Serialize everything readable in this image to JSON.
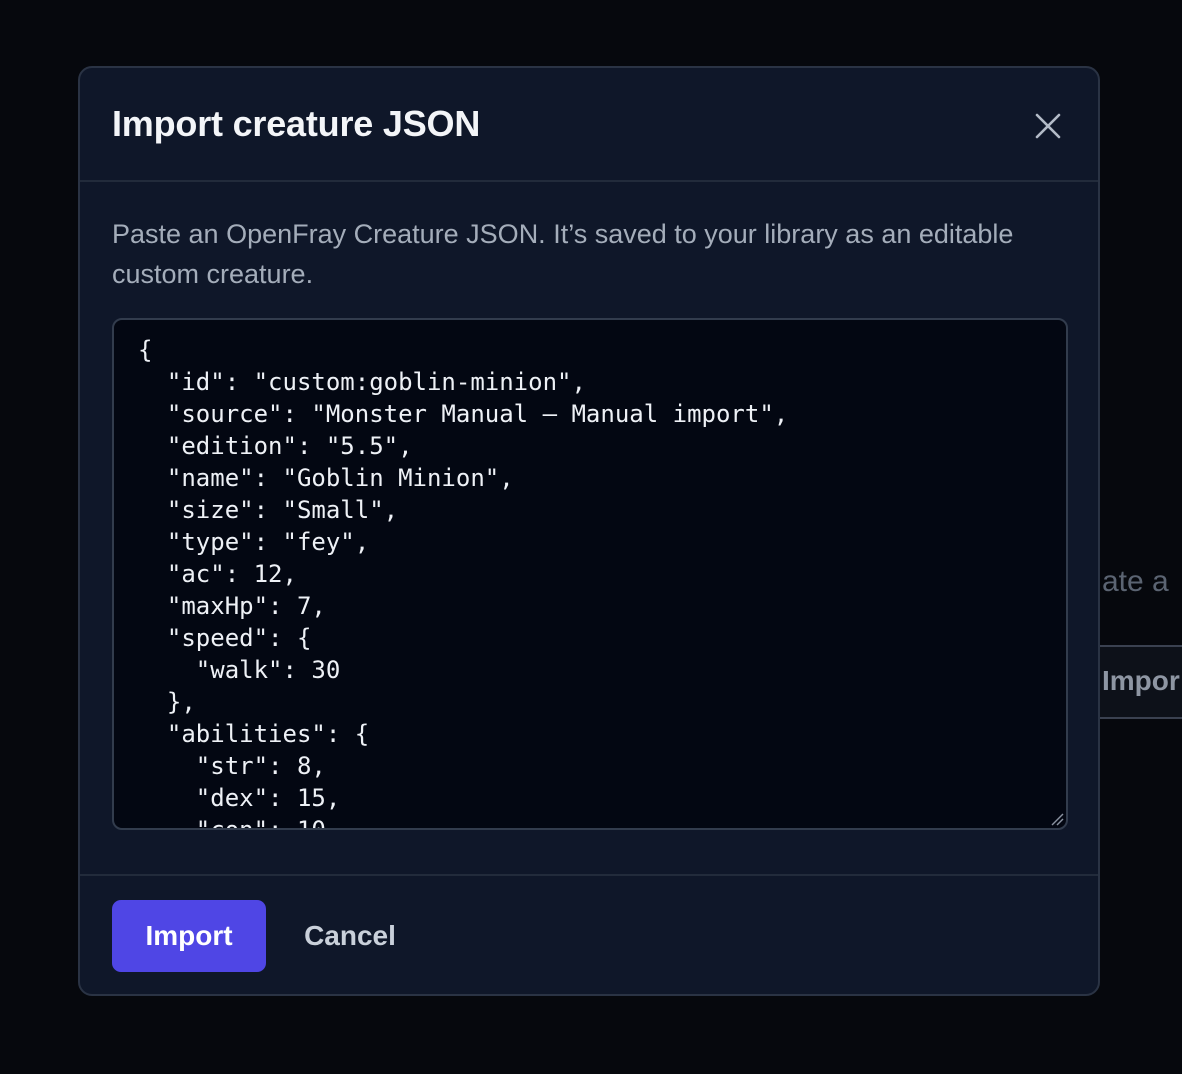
{
  "background": {
    "partial_text": "ate a",
    "partial_button_label": "Impor"
  },
  "dialog": {
    "title": "Import creature JSON",
    "close_icon": "close-icon",
    "description": "Paste an OpenFray Creature JSON. It’s saved to your library as an editable custom creature.",
    "json_value": "{\n  \"id\": \"custom:goblin-minion\",\n  \"source\": \"Monster Manual – Manual import\",\n  \"edition\": \"5.5\",\n  \"name\": \"Goblin Minion\",\n  \"size\": \"Small\",\n  \"type\": \"fey\",\n  \"ac\": 12,\n  \"maxHp\": 7,\n  \"speed\": {\n    \"walk\": 30\n  },\n  \"abilities\": {\n    \"str\": 8,\n    \"dex\": 15,\n    \"con\": 10",
    "import_label": "Import",
    "cancel_label": "Cancel"
  },
  "colors": {
    "accent": "#4f46e5",
    "dialog_background": "#0f1729",
    "editor_background": "#030712"
  }
}
